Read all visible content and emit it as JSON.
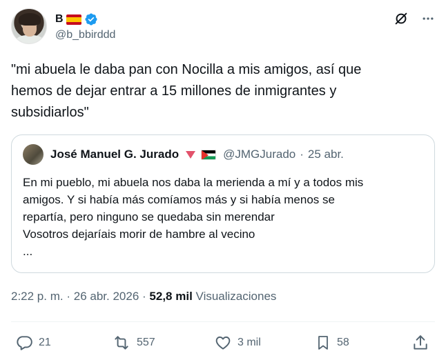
{
  "author": {
    "display_name": "B",
    "handle": "@b_bbirddd",
    "flag_icon": "spain-flag-icon",
    "verified_icon": "verified-badge-icon",
    "verified_color": "#1d9bf0"
  },
  "tweet": {
    "text": "\"mi abuela le daba pan con Nocilla a mis amigos, así que\nhemos de dejar entrar a 15 millones de inmigrantes y\nsubsidiarlos\""
  },
  "quote": {
    "display_name": "José Manuel G. Jurado",
    "handle": "@JMGJurado",
    "separator": "·",
    "date": "25 abr.",
    "text": "En mi pueblo, mi abuela nos daba la merienda a mí y a todos mis\namigos. Y si había más comíamos más y si había menos se\nrepartía, pero ninguno se quedaba sin merendar\nVosotros dejaríais morir de hambre al vecino\n..."
  },
  "meta": {
    "time": "2:22 p. m.",
    "sep1": "·",
    "date": "26 abr. 2026",
    "sep2": "·",
    "views_count": "52,8 mil",
    "views_label": "Visualizaciones"
  },
  "actions": {
    "replies": "21",
    "reposts": "557",
    "likes": "3 mil",
    "bookmarks": "58"
  },
  "colors": {
    "text_primary": "#0f1419",
    "text_secondary": "#536471",
    "border": "#cfd9de",
    "accent": "#1d9bf0"
  }
}
